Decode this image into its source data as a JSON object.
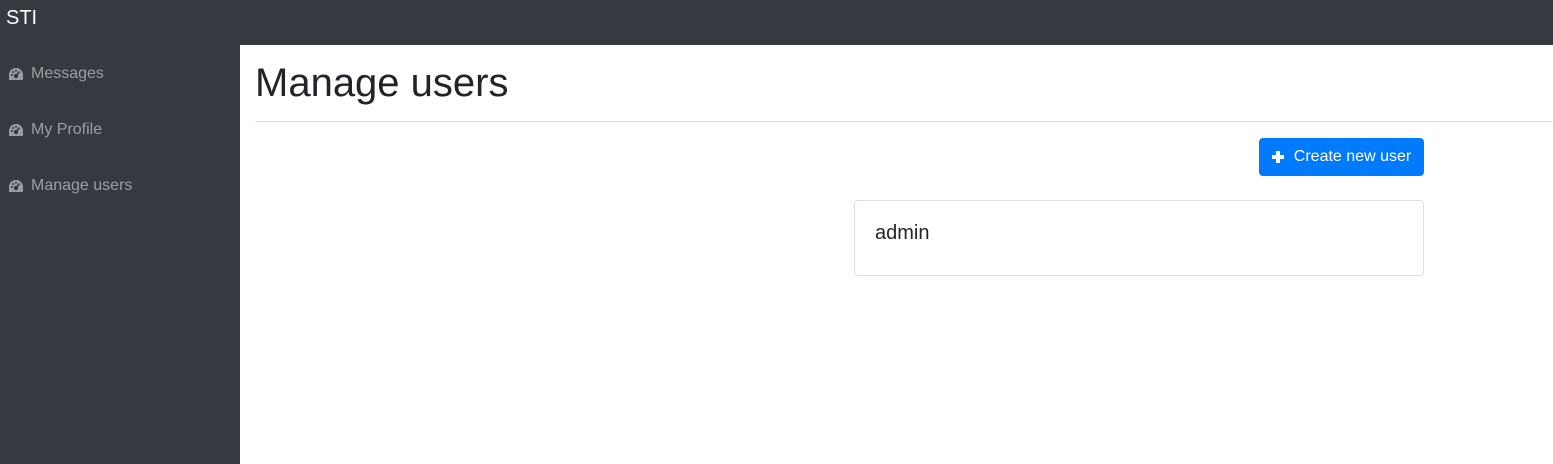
{
  "app": {
    "brand": "STI"
  },
  "sidebar": {
    "items": [
      {
        "label": "Messages",
        "icon": "dashboard-icon"
      },
      {
        "label": "My Profile",
        "icon": "dashboard-icon"
      },
      {
        "label": "Manage users",
        "icon": "dashboard-icon"
      }
    ]
  },
  "main": {
    "title": "Manage users",
    "create_button_label": "Create new user",
    "users": [
      {
        "name": "admin"
      }
    ]
  },
  "colors": {
    "sidebar_bg": "#343a40",
    "primary": "#007bff",
    "page_bg": "#ffffff"
  }
}
